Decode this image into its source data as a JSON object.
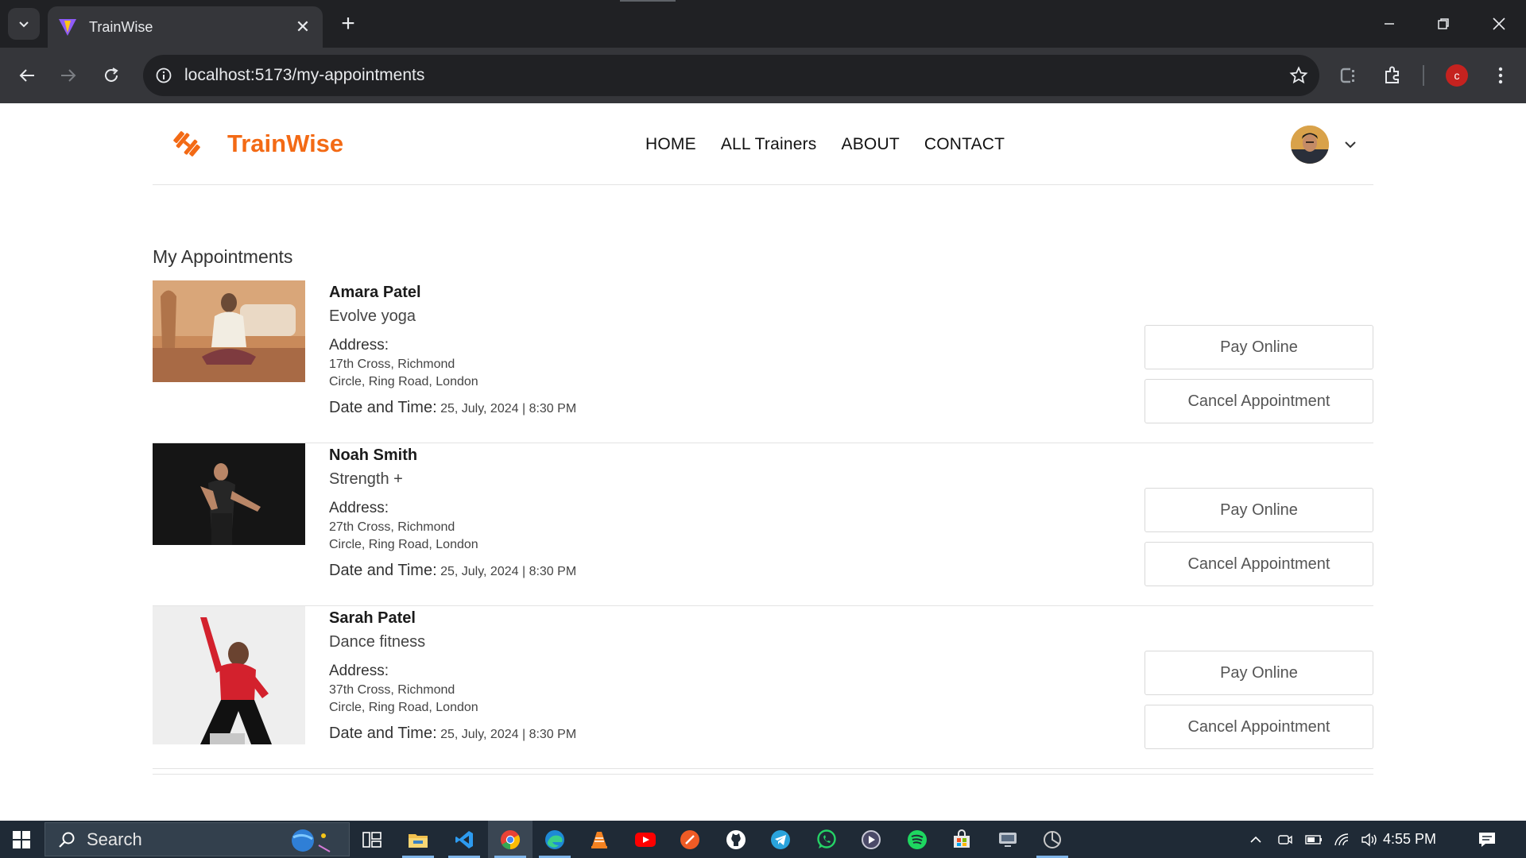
{
  "browser": {
    "tab_title": "TrainWise",
    "url": "localhost:5173/my-appointments",
    "profile_initial": "c"
  },
  "site": {
    "brand": "TrainWise",
    "accent_color": "#f36a15",
    "nav": [
      "HOME",
      "ALL Trainers",
      "ABOUT",
      "CONTACT"
    ]
  },
  "page": {
    "title": "My Appointments",
    "address_label": "Address:",
    "datetime_label": "Date and Time:",
    "pay_label": "Pay Online",
    "cancel_label": "Cancel Appointment"
  },
  "appointments": [
    {
      "name": "Amara Patel",
      "speciality": "Evolve yoga",
      "address_line1": "17th Cross, Richmond",
      "address_line2": "Circle, Ring Road, London",
      "datetime": "25, July, 2024 | 8:30 PM"
    },
    {
      "name": "Noah Smith",
      "speciality": "Strength +",
      "address_line1": "27th Cross, Richmond",
      "address_line2": "Circle, Ring Road, London",
      "datetime": "25, July, 2024 | 8:30 PM"
    },
    {
      "name": "Sarah Patel",
      "speciality": "Dance fitness",
      "address_line1": "37th Cross, Richmond",
      "address_line2": "Circle, Ring Road, London",
      "datetime": "25, July, 2024 | 8:30 PM"
    }
  ],
  "taskbar": {
    "search_label": "Search",
    "time": "4:55 PM",
    "apps": [
      "task-view",
      "file-explorer",
      "vscode",
      "chrome",
      "edge",
      "vlc",
      "youtube",
      "postman",
      "github",
      "telegram",
      "whatsapp",
      "media-player",
      "spotify",
      "store",
      "remote-desktop",
      "cursor"
    ]
  }
}
